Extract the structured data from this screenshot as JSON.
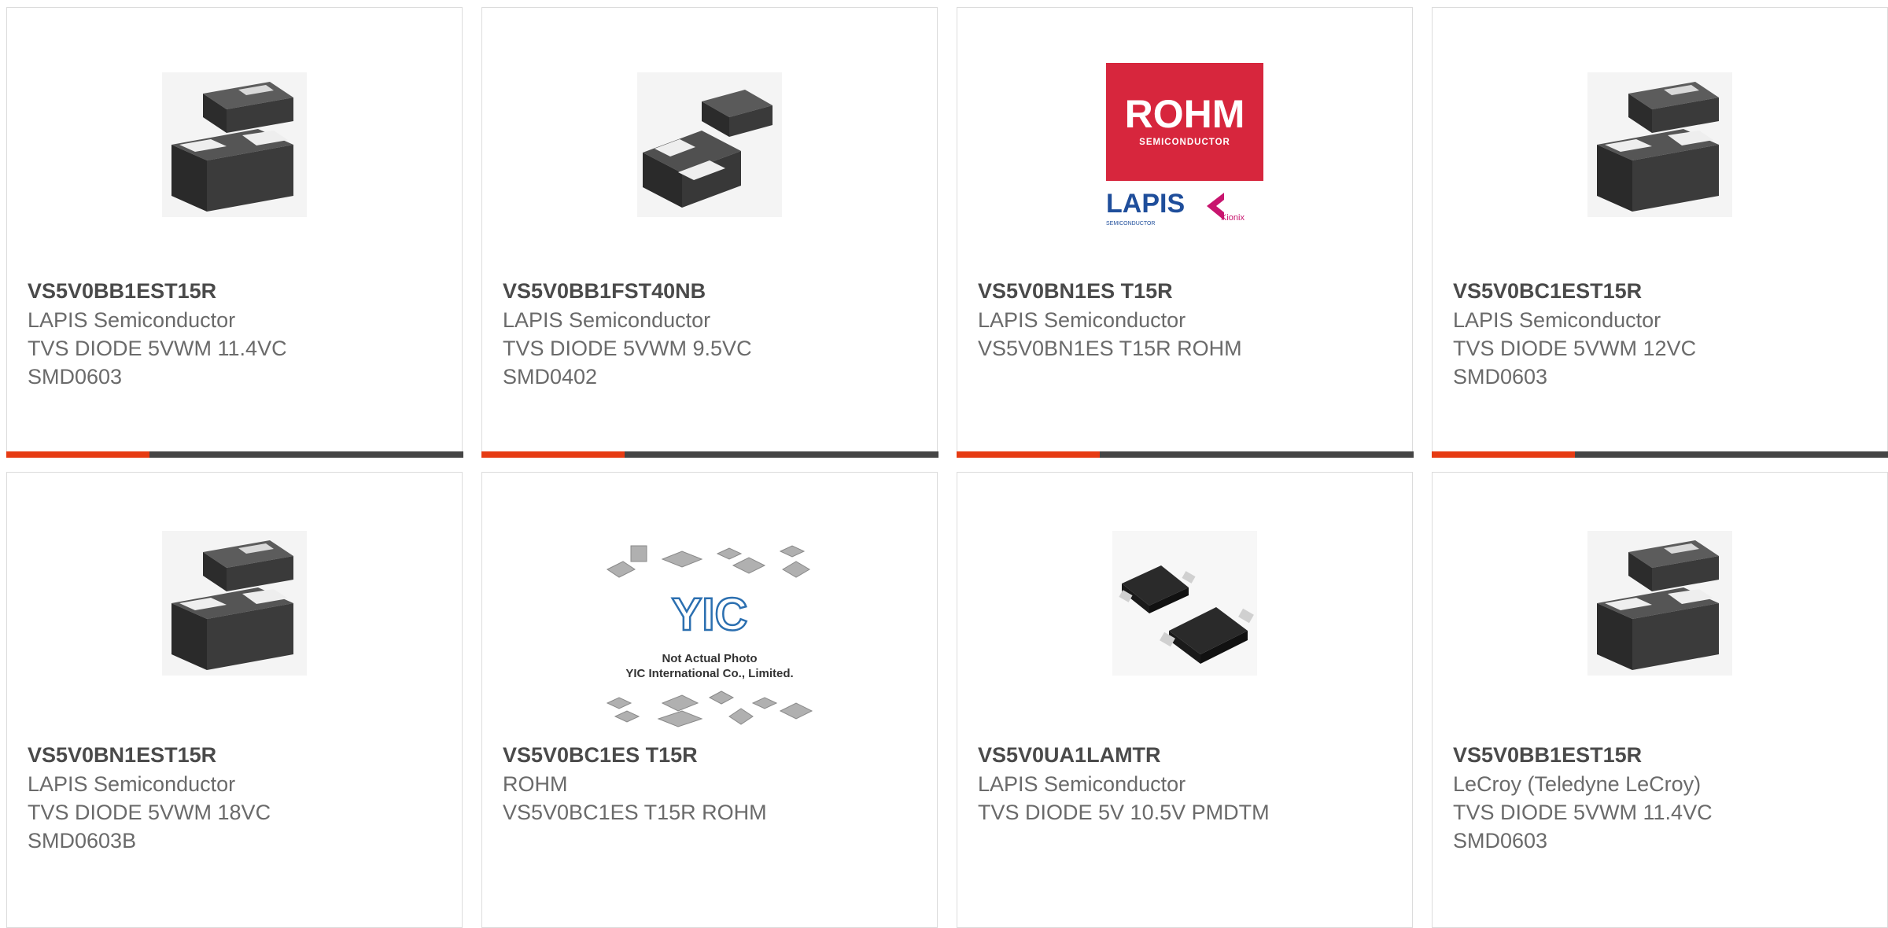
{
  "products": [
    {
      "part": "VS5V0BB1EST15R",
      "manufacturer": "LAPIS Semiconductor",
      "line1": "TVS DIODE 5VWM 11.4VC",
      "line2": "SMD0603",
      "image": "smd-diode-package-icon"
    },
    {
      "part": "VS5V0BB1FST40NB",
      "manufacturer": "LAPIS Semiconductor",
      "line1": "TVS DIODE 5VWM 9.5VC",
      "line2": "SMD0402",
      "image": "smd-diode-package-icon"
    },
    {
      "part": "VS5V0BN1ES T15R",
      "manufacturer": "LAPIS Semiconductor",
      "line1": "VS5V0BN1ES T15R ROHM",
      "line2": "",
      "image": "rohm-lapis-kionix-logo"
    },
    {
      "part": "VS5V0BC1EST15R",
      "manufacturer": "LAPIS Semiconductor",
      "line1": "TVS DIODE 5VWM 12VC",
      "line2": "SMD0603",
      "image": "smd-diode-package-icon"
    },
    {
      "part": "VS5V0BN1EST15R",
      "manufacturer": "LAPIS Semiconductor",
      "line1": "TVS DIODE 5VWM 18VC",
      "line2": "SMD0603B",
      "image": "smd-diode-package-icon"
    },
    {
      "part": "VS5V0BC1ES T15R",
      "manufacturer": "ROHM",
      "line1": "VS5V0BC1ES T15R ROHM",
      "line2": "",
      "image": "yic-not-actual-photo-placeholder"
    },
    {
      "part": "VS5V0UA1LAMTR",
      "manufacturer": "LAPIS Semiconductor",
      "line1": "TVS DIODE 5V 10.5V PMDTM",
      "line2": "",
      "image": "pmdtm-package-icon"
    },
    {
      "part": "VS5V0BB1EST15R",
      "manufacturer": "LeCroy (Teledyne LeCroy)",
      "line1": "TVS DIODE 5VWM 11.4VC",
      "line2": "SMD0603",
      "image": "smd-diode-package-icon"
    }
  ],
  "logos": {
    "rohm": "ROHM",
    "rohm_sub": "SEMICONDUCTOR",
    "lapis": "LAPIS",
    "lapis_sub": "SEMICONDUCTOR",
    "kionix": "Kionix",
    "yic": "YIC",
    "placeholder_line1": "Not Actual Photo",
    "placeholder_line2": "YIC International Co., Limited."
  },
  "colors": {
    "accent": "#e63b13",
    "bar_dark": "#454545",
    "border": "#dcdcdc",
    "rohm_red": "#d7263d",
    "lapis_blue": "#1f4e9b",
    "kionix_magenta": "#c8156e",
    "yic_blue": "#2b6fb0"
  }
}
